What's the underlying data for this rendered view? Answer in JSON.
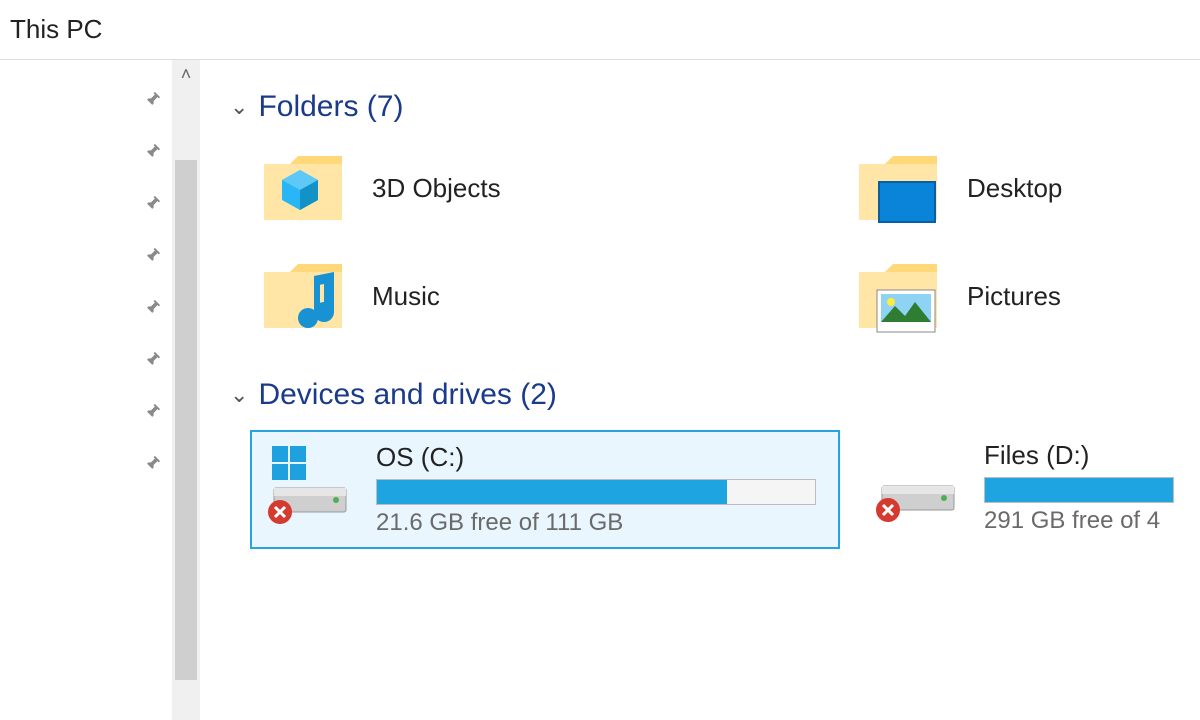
{
  "title": "This PC",
  "folders": {
    "header": "Folders (7)",
    "items": [
      {
        "label": "3D Objects"
      },
      {
        "label": "Desktop"
      },
      {
        "label": "Music"
      },
      {
        "label": "Pictures"
      }
    ]
  },
  "drives": {
    "header": "Devices and drives (2)",
    "items": [
      {
        "label": "OS (C:)",
        "free_text": "21.6 GB free of 111 GB",
        "used_pct": 80,
        "selected": true,
        "system": true
      },
      {
        "label": "Files (D:)",
        "free_text": "291 GB free of 4",
        "used_pct": 100,
        "selected": false,
        "system": false
      }
    ]
  }
}
